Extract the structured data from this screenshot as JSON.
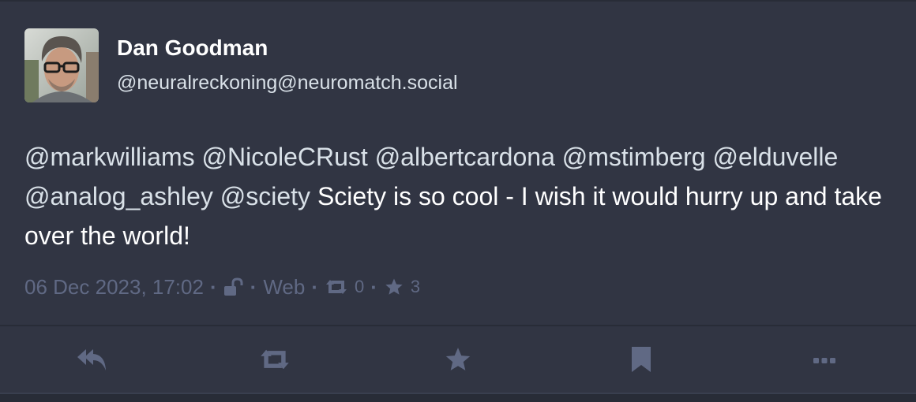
{
  "author": {
    "display_name": "Dan Goodman",
    "account": "@neuralreckoning@neuromatch.social",
    "avatar_icon": "avatar-photo"
  },
  "post": {
    "mentions": [
      "@markwilliams",
      "@NicoleCRust",
      "@albertcardona",
      "@mstimberg",
      "@elduvelle",
      "@analog_ashley",
      "@sciety"
    ],
    "text": "Sciety is so cool - I wish it would hurry up and take over the world!"
  },
  "meta": {
    "timestamp": "06 Dec 2023, 17:02",
    "separator": "·",
    "visibility_icon": "unlock-icon",
    "application": "Web",
    "boost_icon": "retweet-icon",
    "boosts": "0",
    "favourite_icon": "star-icon",
    "favourites": "3"
  },
  "actions": [
    {
      "name": "reply",
      "icon": "reply-all-icon"
    },
    {
      "name": "boost",
      "icon": "retweet-icon"
    },
    {
      "name": "favourite",
      "icon": "star-icon"
    },
    {
      "name": "bookmark",
      "icon": "bookmark-icon"
    },
    {
      "name": "more",
      "icon": "ellipsis-icon"
    }
  ],
  "colors": {
    "background": "#313543",
    "text": "#ffffff",
    "mention": "#d9e1e8",
    "muted": "#606984"
  }
}
